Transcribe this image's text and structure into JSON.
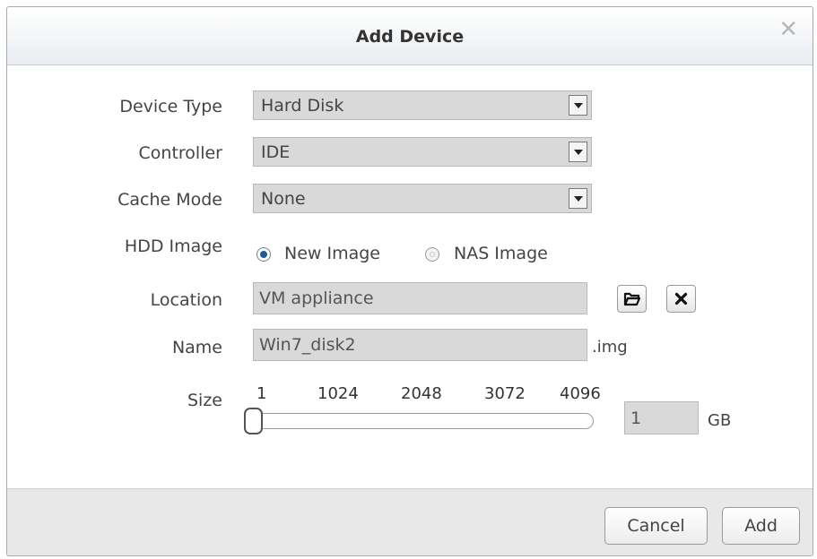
{
  "dialog": {
    "title": "Add Device",
    "close_glyph": "✕"
  },
  "form": {
    "device_type": {
      "label": "Device Type",
      "value": "Hard Disk"
    },
    "controller": {
      "label": "Controller",
      "value": "IDE"
    },
    "cache_mode": {
      "label": "Cache Mode",
      "value": "None"
    },
    "hdd_image": {
      "label": "HDD Image",
      "options": [
        {
          "label": "New Image",
          "selected": true
        },
        {
          "label": "NAS Image",
          "selected": false
        }
      ]
    },
    "location": {
      "label": "Location",
      "value": "VM appliance",
      "browse_icon": "folder-open-icon",
      "clear_icon": "clear-x-icon"
    },
    "name": {
      "label": "Name",
      "value": "Win7_disk2",
      "suffix": ".img"
    },
    "size": {
      "label": "Size",
      "ticks": [
        "1",
        "1024",
        "2048",
        "3072",
        "4096"
      ],
      "slider_min": 1,
      "slider_max": 4096,
      "slider_value": 1,
      "value": "1",
      "unit": "GB"
    }
  },
  "footer": {
    "cancel_label": "Cancel",
    "add_label": "Add"
  }
}
